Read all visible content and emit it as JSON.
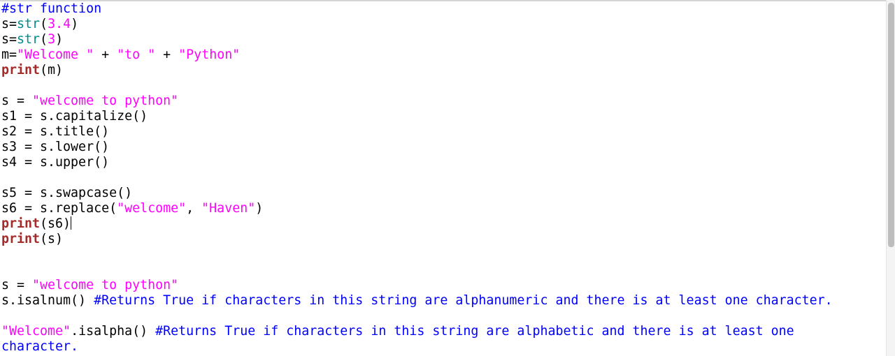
{
  "colors": {
    "default": "#000000",
    "keyword": "#a52a2a",
    "builtin": "#008b8b",
    "string": "#ff00ff",
    "number": "#ff00ff",
    "comment": "#0000ff"
  },
  "lines": [
    [
      {
        "t": "#str function",
        "k": "comment"
      }
    ],
    [
      {
        "t": "s=",
        "k": "default"
      },
      {
        "t": "str",
        "k": "builtin"
      },
      {
        "t": "(",
        "k": "default"
      },
      {
        "t": "3.4",
        "k": "number"
      },
      {
        "t": ")",
        "k": "default"
      }
    ],
    [
      {
        "t": "s=",
        "k": "default"
      },
      {
        "t": "str",
        "k": "builtin"
      },
      {
        "t": "(",
        "k": "default"
      },
      {
        "t": "3",
        "k": "number"
      },
      {
        "t": ")",
        "k": "default"
      }
    ],
    [
      {
        "t": "m=",
        "k": "default"
      },
      {
        "t": "\"Welcome \"",
        "k": "string"
      },
      {
        "t": " + ",
        "k": "default"
      },
      {
        "t": "\"to \"",
        "k": "string"
      },
      {
        "t": " + ",
        "k": "default"
      },
      {
        "t": "\"Python\"",
        "k": "string"
      }
    ],
    [
      {
        "t": "print",
        "k": "keyword"
      },
      {
        "t": "(m)",
        "k": "default"
      }
    ],
    [],
    [
      {
        "t": "s = ",
        "k": "default"
      },
      {
        "t": "\"welcome to python\"",
        "k": "string"
      }
    ],
    [
      {
        "t": "s1 = s.capitalize()",
        "k": "default"
      }
    ],
    [
      {
        "t": "s2 = s.title()",
        "k": "default"
      }
    ],
    [
      {
        "t": "s3 = s.lower()",
        "k": "default"
      }
    ],
    [
      {
        "t": "s4 = s.upper()",
        "k": "default"
      }
    ],
    [],
    [
      {
        "t": "s5 = s.swapcase()",
        "k": "default"
      }
    ],
    [
      {
        "t": "s6 = s.replace(",
        "k": "default"
      },
      {
        "t": "\"welcome\"",
        "k": "string"
      },
      {
        "t": ", ",
        "k": "default"
      },
      {
        "t": "\"Haven\"",
        "k": "string"
      },
      {
        "t": ")",
        "k": "default"
      }
    ],
    [
      {
        "t": "print",
        "k": "keyword"
      },
      {
        "t": "(s6)",
        "k": "default"
      },
      {
        "t": "",
        "k": "caret"
      }
    ],
    [
      {
        "t": "print",
        "k": "keyword"
      },
      {
        "t": "(s)",
        "k": "default"
      }
    ],
    [],
    [],
    [
      {
        "t": "s = ",
        "k": "default"
      },
      {
        "t": "\"welcome to python\"",
        "k": "string"
      }
    ],
    [
      {
        "t": "s.isalnum() ",
        "k": "default"
      },
      {
        "t": "#Returns True if characters in this string are alphanumeric and there is at least one character.",
        "k": "comment"
      }
    ],
    [],
    [
      {
        "t": "\"Welcome\"",
        "k": "string"
      },
      {
        "t": ".isalpha() ",
        "k": "default"
      },
      {
        "t": "#Returns True if characters in this string are alphabetic and there is at least one",
        "k": "comment"
      }
    ],
    [
      {
        "t": "character.",
        "k": "comment"
      }
    ]
  ]
}
